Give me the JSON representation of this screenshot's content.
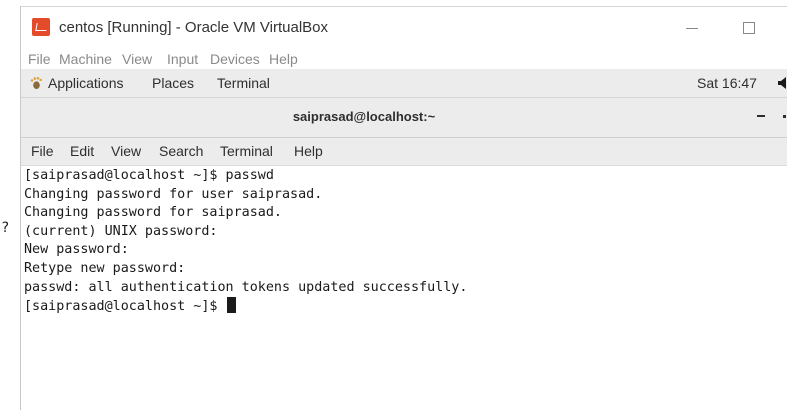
{
  "left_margin_mark": "?",
  "virtualbox": {
    "window_title": "centos [Running] - Oracle VM VirtualBox",
    "menu": [
      "File",
      "Machine",
      "View",
      "Input",
      "Devices",
      "Help"
    ]
  },
  "gnome_panel": {
    "applications": "Applications",
    "places": "Places",
    "terminal": "Terminal",
    "clock": "Sat 16:47"
  },
  "terminal": {
    "title": "saiprasad@localhost:~",
    "menu": [
      "File",
      "Edit",
      "View",
      "Search",
      "Terminal",
      "Help"
    ],
    "lines": [
      "[saiprasad@localhost ~]$ passwd",
      "Changing password for user saiprasad.",
      "Changing password for saiprasad.",
      "(current) UNIX password:",
      "New password:",
      "Retype new password:",
      "passwd: all authentication tokens updated successfully.",
      "[saiprasad@localhost ~]$ "
    ]
  },
  "colors": {
    "vbox_icon": "#e34b2a",
    "panel_bg": "#ececec",
    "terminal_bg": "#ffffff",
    "terminal_text": "#1a1a1a"
  },
  "icons": {
    "vbox_app": "virtualbox-icon",
    "applications": "gnome-foot-icon",
    "volume": "speaker-icon"
  }
}
